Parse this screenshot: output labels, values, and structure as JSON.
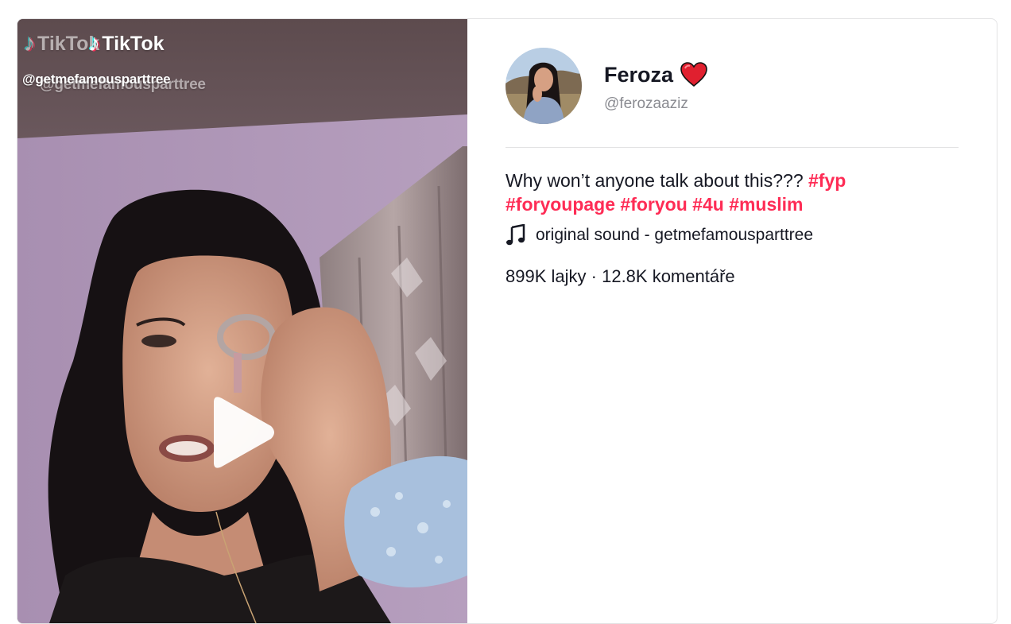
{
  "video": {
    "watermark_brand": "TikTok",
    "watermark_username": "@getmefamousparttree",
    "watermark_username_ghost": "@getmefamousparttree"
  },
  "author": {
    "display_name": "Feroza",
    "username": "@ferozaaziz"
  },
  "caption": {
    "text": "Why won’t anyone talk about this???",
    "hashtags": [
      "#fyp",
      "#foryoupage",
      "#foryou",
      "#4u",
      "#muslim"
    ]
  },
  "music": {
    "label": "original sound - getmefamousparttree"
  },
  "stats": {
    "likes": "899K lajky",
    "separator": "·",
    "comments": "12.8K komentáře"
  },
  "colors": {
    "accent": "#fe2c55",
    "text": "#161823",
    "muted": "#8a8b91",
    "divider": "#e3e3e4"
  }
}
